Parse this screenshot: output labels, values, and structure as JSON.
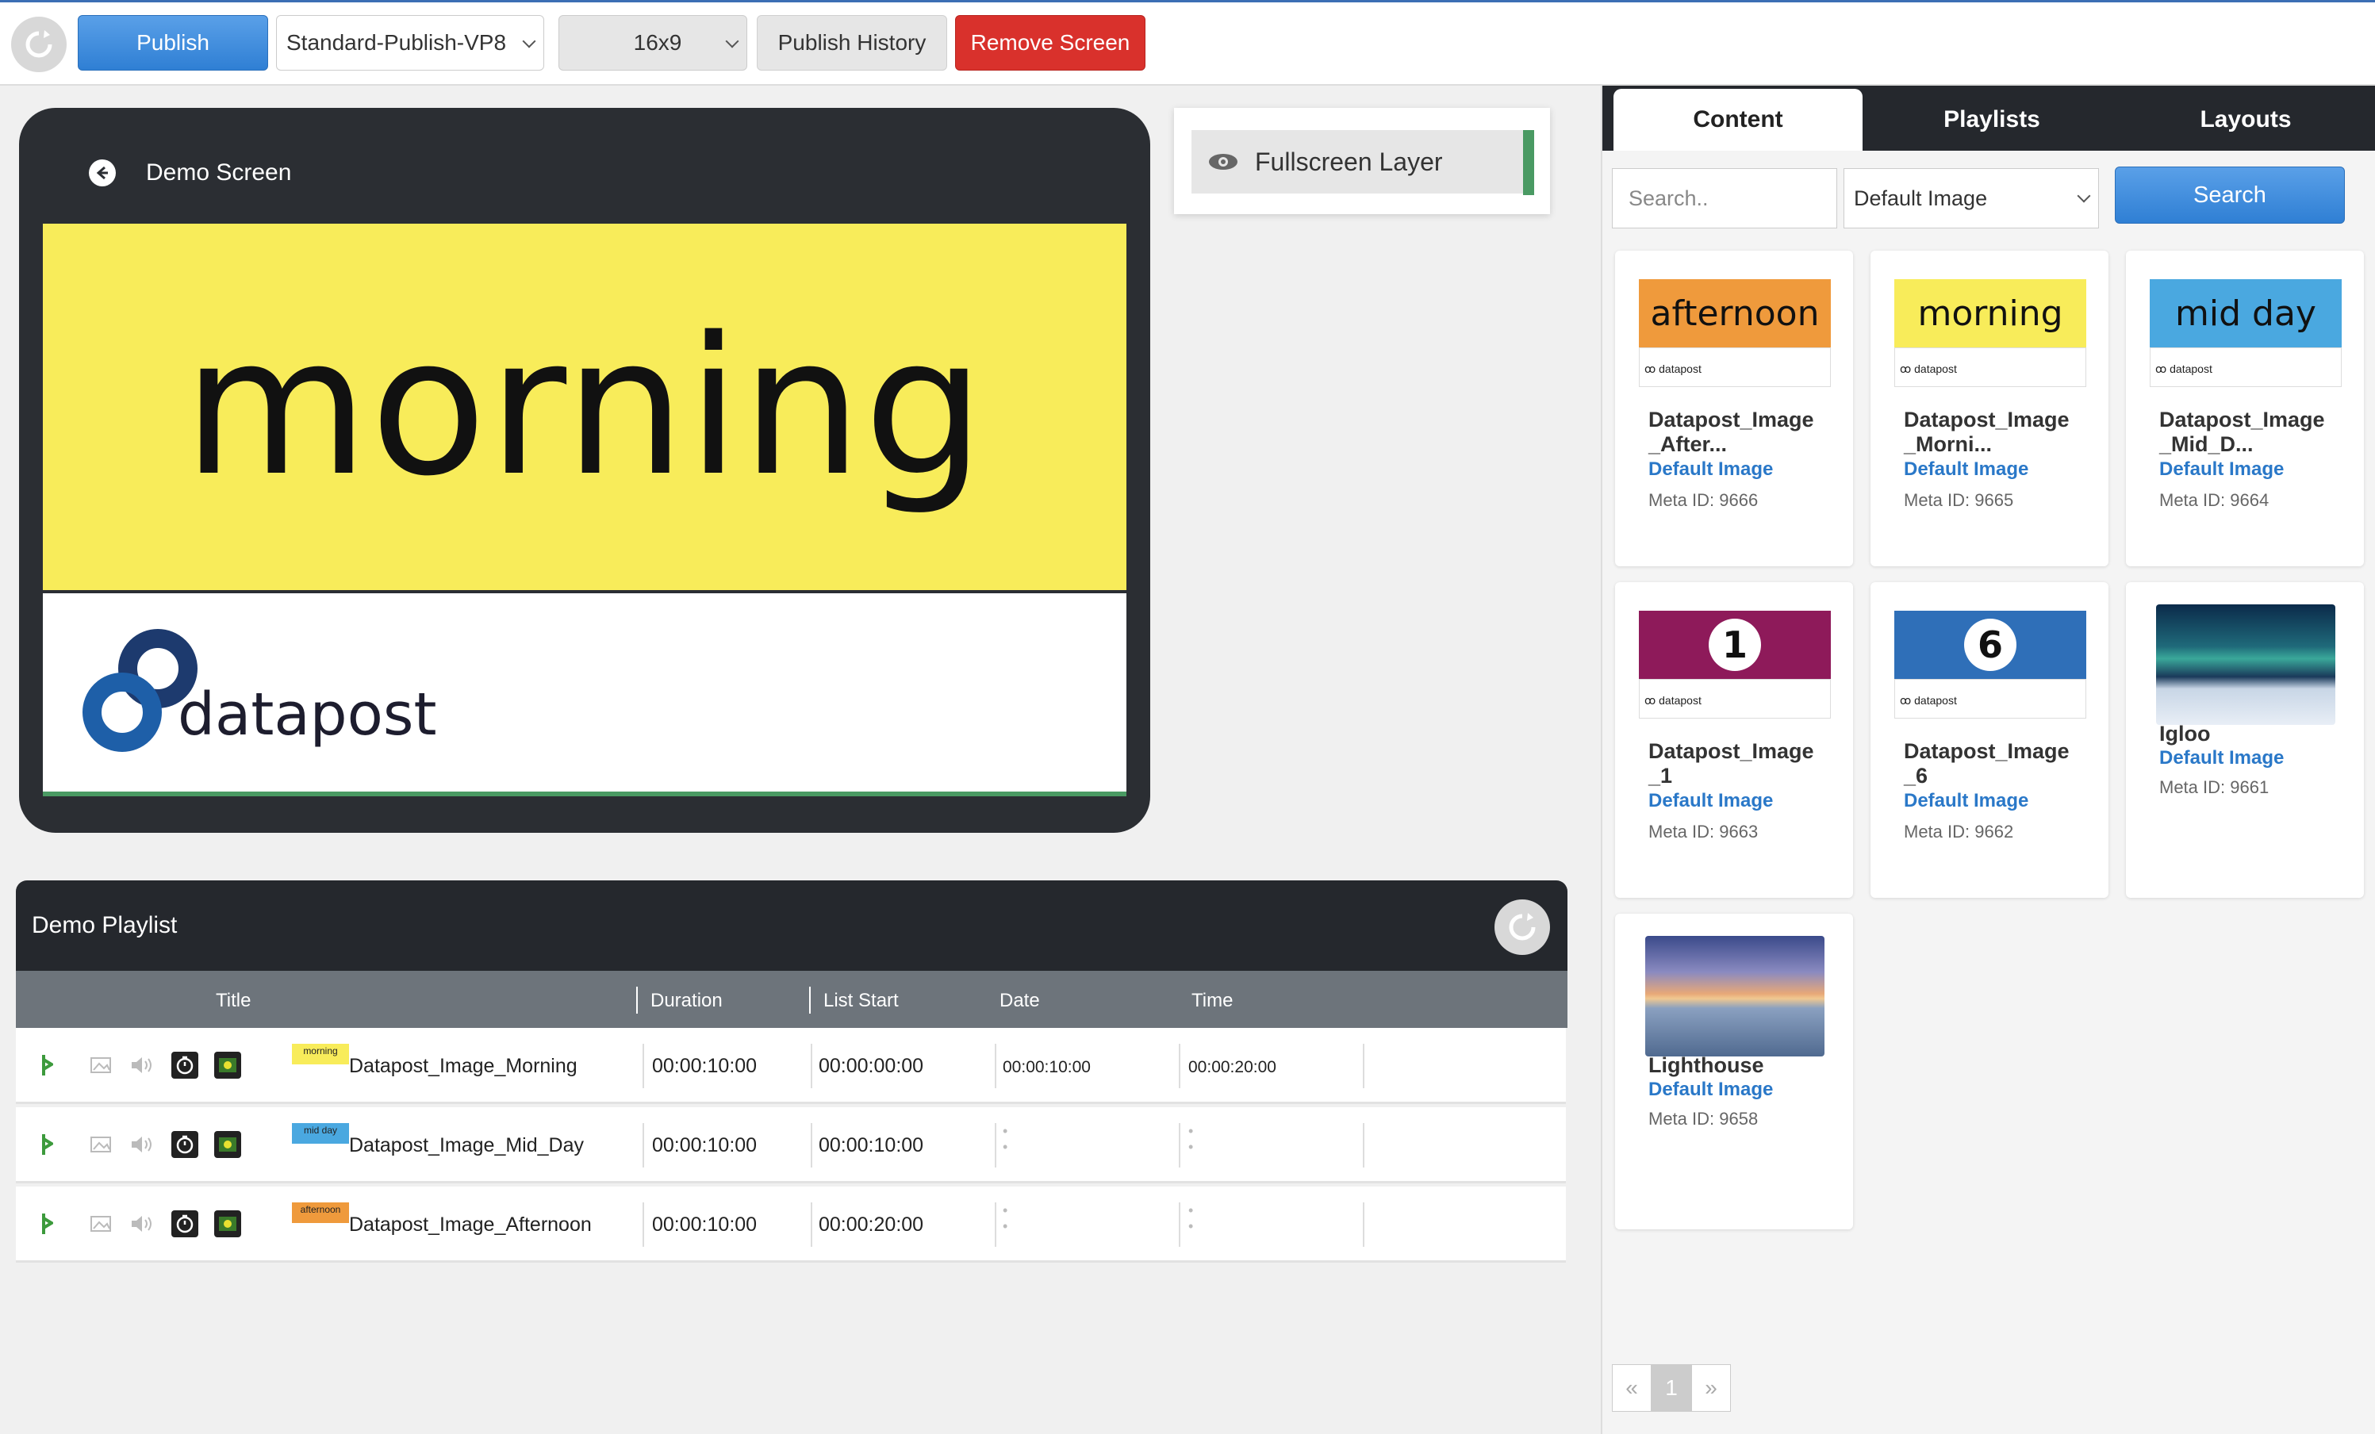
{
  "toolbar": {
    "publish_label": "Publish",
    "profile_select": "Standard-Publish-VP8",
    "aspect_select": "16x9",
    "history_label": "Publish History",
    "remove_label": "Remove Screen"
  },
  "screen": {
    "title": "Demo Screen",
    "preview_word": "morning",
    "logo_text": "datapost"
  },
  "layer": {
    "label": "Fullscreen Layer"
  },
  "playlist": {
    "title": "Demo Playlist",
    "columns": {
      "title": "Title",
      "duration": "Duration",
      "list_start": "List Start",
      "date": "Date",
      "time": "Time"
    },
    "rows": [
      {
        "thumb": "morning",
        "title": "Datapost_Image_Morning",
        "duration": "00:00:10:00",
        "list_start": "00:00:00:00",
        "date": "00:00:10:00",
        "time": "00:00:20:00"
      },
      {
        "thumb": "mid day",
        "title": "Datapost_Image_Mid_Day",
        "duration": "00:00:10:00",
        "list_start": "00:00:10:00",
        "date": "",
        "time": ""
      },
      {
        "thumb": "afternoon",
        "title": "Datapost_Image_Afternoon",
        "duration": "00:00:10:00",
        "list_start": "00:00:20:00",
        "date": "",
        "time": ""
      }
    ]
  },
  "panel": {
    "tabs": [
      "Content",
      "Playlists",
      "Layouts"
    ],
    "search_placeholder": "Search..",
    "filter_select": "Default Image",
    "search_label": "Search",
    "cards": [
      {
        "image_text": "afternoon",
        "name": "Datapost_Image _After...",
        "type": "Default Image",
        "meta": "Meta ID: 9666"
      },
      {
        "image_text": "morning",
        "name": "Datapost_Image _Morni...",
        "type": "Default Image",
        "meta": "Meta ID: 9665"
      },
      {
        "image_text": "mid day",
        "name": "Datapost_Image _Mid_D...",
        "type": "Default Image",
        "meta": "Meta ID: 9664"
      },
      {
        "image_text": "1",
        "name": "Datapost_Image _1",
        "type": "Default Image",
        "meta": "Meta ID: 9663"
      },
      {
        "image_text": "6",
        "name": "Datapost_Image _6",
        "type": "Default Image",
        "meta": "Meta ID: 9662"
      },
      {
        "image_text": "",
        "name": "Igloo",
        "type": "Default Image",
        "meta": "Meta ID: 9661"
      },
      {
        "image_text": "",
        "name": "Lighthouse",
        "type": "Default Image",
        "meta": "Meta ID: 9658"
      }
    ],
    "pager": {
      "prev": "«",
      "current": "1",
      "next": "»"
    }
  },
  "colors": {
    "accent_blue": "#2f7fd4",
    "danger_red": "#d9312c",
    "dark_header": "#25282d",
    "layer_green": "#4a9a63"
  }
}
